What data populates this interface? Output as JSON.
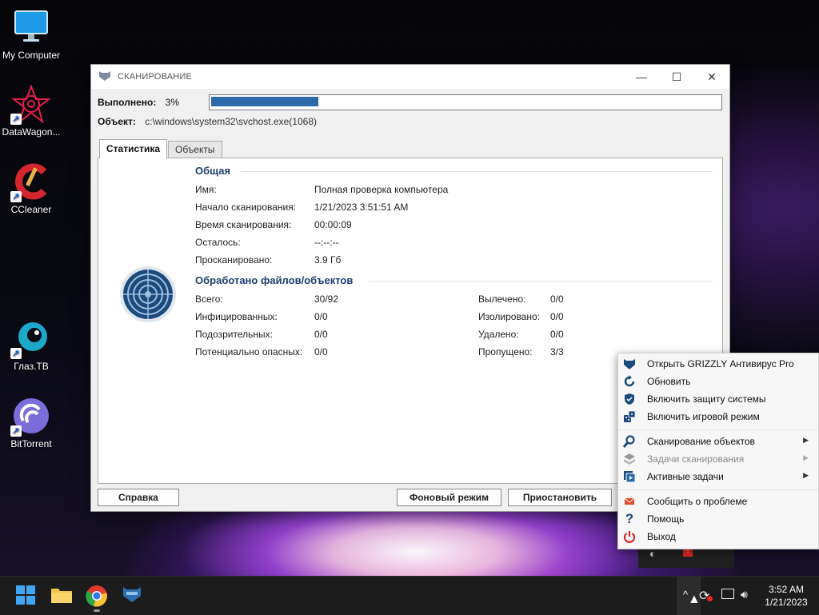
{
  "desktop": {
    "icons": [
      {
        "label": "My Computer"
      },
      {
        "label": "DataWagon..."
      },
      {
        "label": "CCleaner"
      },
      {
        "label": "Глаз.ТВ"
      },
      {
        "label": "BitTorrent"
      }
    ]
  },
  "scan_window": {
    "title": "СКАНИРОВАНИЕ",
    "progress_label": "Выполнено:",
    "progress_text": "3%",
    "progress_value": 0.03,
    "object_label": "Объект:",
    "object_value": "c:\\windows\\system32\\svchost.exe(1068)",
    "tabs": [
      {
        "label": "Статистика",
        "active": true
      },
      {
        "label": "Объекты",
        "active": false
      }
    ],
    "general": {
      "heading": "Общая",
      "rows": [
        {
          "label": "Имя:",
          "value": "Полная проверка компьютера"
        },
        {
          "label": "Начало сканирования:",
          "value": "1/21/2023 3:51:51 AM"
        },
        {
          "label": "Время сканирования:",
          "value": "00:00:09"
        },
        {
          "label": "Осталось:",
          "value": "--:--:--"
        },
        {
          "label": "Просканировано:",
          "value": "3.9 Гб"
        }
      ]
    },
    "processed": {
      "heading": "Обработано файлов/объектов",
      "left": [
        {
          "label": "Всего:",
          "value": "30/92"
        },
        {
          "label": "Инфицированных:",
          "value": "0/0"
        },
        {
          "label": "Подозрительных:",
          "value": "0/0"
        },
        {
          "label": "Потенциально опасных:",
          "value": "0/0"
        }
      ],
      "right": [
        {
          "label": "Вылечено:",
          "value": "0/0"
        },
        {
          "label": "Изолировано:",
          "value": "0/0"
        },
        {
          "label": "Удалено:",
          "value": "0/0"
        },
        {
          "label": "Пропущено:",
          "value": "3/3"
        }
      ]
    },
    "buttons": {
      "help": "Справка",
      "background": "Фоновый режим",
      "pause": "Приостановить"
    }
  },
  "context_menu": {
    "items": [
      {
        "label": "Открыть GRIZZLY Антивирус Pro",
        "icon": "grizzly-icon"
      },
      {
        "label": "Обновить",
        "icon": "refresh-icon"
      },
      {
        "label": "Включить защиту системы",
        "icon": "shield-icon"
      },
      {
        "label": "Включить игровой режим",
        "icon": "dice-icon"
      },
      {
        "label": "Сканирование объектов",
        "icon": "search-icon",
        "submenu": true
      },
      {
        "label": "Задачи сканирования",
        "icon": "tasks-icon",
        "submenu": true,
        "disabled": true
      },
      {
        "label": "Активные задачи",
        "icon": "active-tasks-icon",
        "submenu": true
      },
      {
        "label": "Сообщить о проблеме",
        "icon": "mail-icon"
      },
      {
        "label": "Помощь",
        "icon": "help-icon"
      },
      {
        "label": "Выход",
        "icon": "power-icon"
      }
    ]
  },
  "taskbar": {
    "time": "3:52 AM",
    "date": "1/21/2023"
  },
  "colors": {
    "accent": "#2a6aa8",
    "heading": "#1c3f6e",
    "exit_red": "#d9262b"
  }
}
